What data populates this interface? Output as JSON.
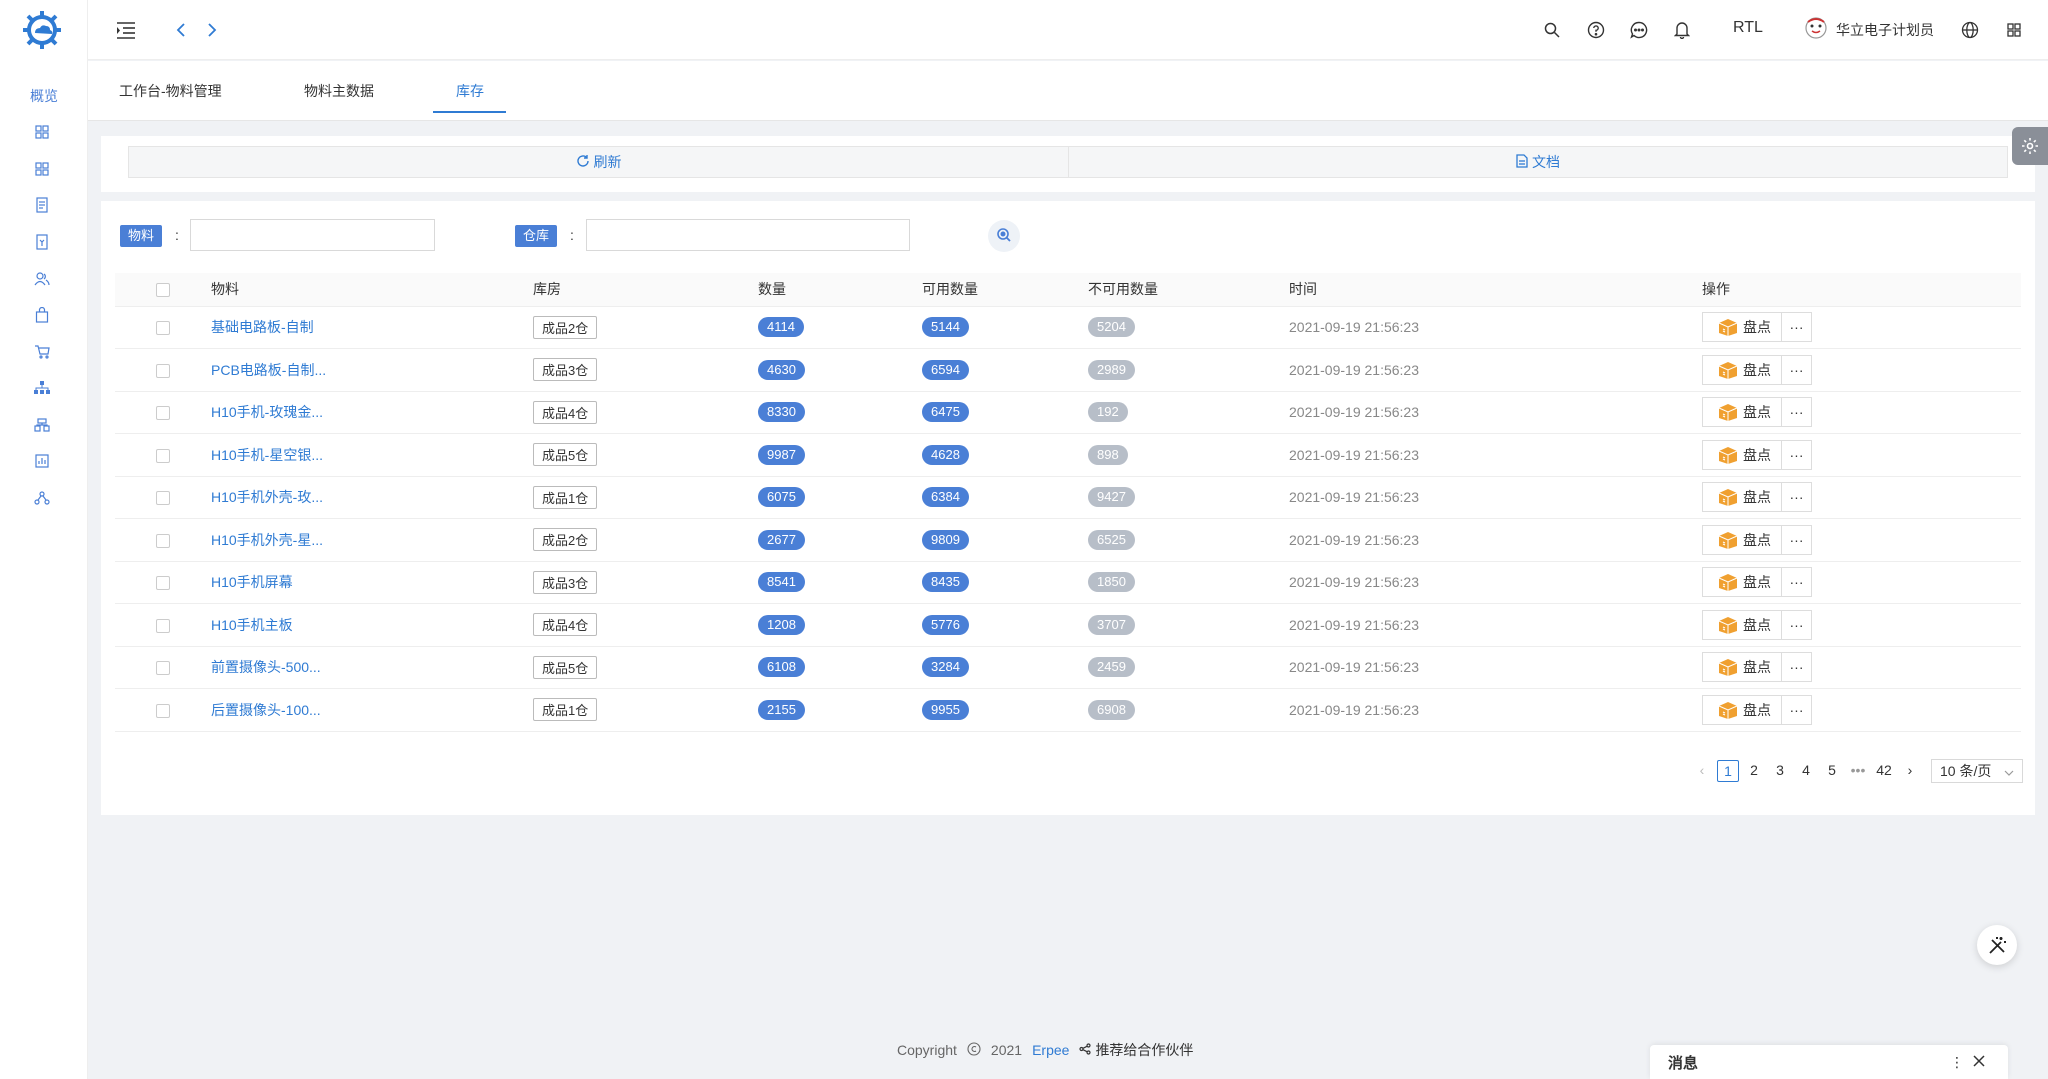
{
  "sidebar": {
    "overview_label": "概览",
    "icons": [
      "grid-icon",
      "grid-icon",
      "document-icon",
      "invoice-icon",
      "users-icon",
      "bag-icon",
      "cart-icon",
      "org-icon",
      "warehouse-icon",
      "report-icon",
      "network-icon"
    ]
  },
  "topbar": {
    "rtl_label": "RTL",
    "user_name": "华立电子计划员"
  },
  "tabs": [
    {
      "label": "工作台-物料管理"
    },
    {
      "label": "物料主数据"
    },
    {
      "label": "库存"
    }
  ],
  "toolbar": {
    "refresh_label": "刷新",
    "docs_label": "文档"
  },
  "filters": {
    "material_label": "物料",
    "warehouse_label": "仓库",
    "colon": ":",
    "material_value": "",
    "warehouse_value": ""
  },
  "table": {
    "headers": {
      "material": "物料",
      "warehouse": "库房",
      "quantity": "数量",
      "available": "可用数量",
      "unavailable": "不可用数量",
      "time": "时间",
      "actions": "操作"
    },
    "action_label": "盘点",
    "more_label": "···",
    "rows": [
      {
        "material": "基础电路板-自制",
        "warehouse": "成品2仓",
        "quantity": "4114",
        "available": "5144",
        "unavailable": "5204",
        "time": "2021-09-19 21:56:23"
      },
      {
        "material": "PCB电路板-自制...",
        "warehouse": "成品3仓",
        "quantity": "4630",
        "available": "6594",
        "unavailable": "2989",
        "time": "2021-09-19 21:56:23"
      },
      {
        "material": "H10手机-玫瑰金...",
        "warehouse": "成品4仓",
        "quantity": "8330",
        "available": "6475",
        "unavailable": "192",
        "time": "2021-09-19 21:56:23"
      },
      {
        "material": "H10手机-星空银...",
        "warehouse": "成品5仓",
        "quantity": "9987",
        "available": "4628",
        "unavailable": "898",
        "time": "2021-09-19 21:56:23"
      },
      {
        "material": "H10手机外壳-玫...",
        "warehouse": "成品1仓",
        "quantity": "6075",
        "available": "6384",
        "unavailable": "9427",
        "time": "2021-09-19 21:56:23"
      },
      {
        "material": "H10手机外壳-星...",
        "warehouse": "成品2仓",
        "quantity": "2677",
        "available": "9809",
        "unavailable": "6525",
        "time": "2021-09-19 21:56:23"
      },
      {
        "material": "H10手机屏幕",
        "warehouse": "成品3仓",
        "quantity": "8541",
        "available": "8435",
        "unavailable": "1850",
        "time": "2021-09-19 21:56:23"
      },
      {
        "material": "H10手机主板",
        "warehouse": "成品4仓",
        "quantity": "1208",
        "available": "5776",
        "unavailable": "3707",
        "time": "2021-09-19 21:56:23"
      },
      {
        "material": "前置摄像头-500...",
        "warehouse": "成品5仓",
        "quantity": "6108",
        "available": "3284",
        "unavailable": "2459",
        "time": "2021-09-19 21:56:23"
      },
      {
        "material": "后置摄像头-100...",
        "warehouse": "成品1仓",
        "quantity": "2155",
        "available": "9955",
        "unavailable": "6908",
        "time": "2021-09-19 21:56:23"
      }
    ]
  },
  "pagination": {
    "pages": [
      "1",
      "2",
      "3",
      "4",
      "5"
    ],
    "ellipsis": "•••",
    "last_page": "42",
    "page_size": "10 条/页",
    "current": "1"
  },
  "footer": {
    "copyright": "Copyright",
    "year": "2021",
    "brand": "Erpee",
    "partner": "推荐给合作伙伴"
  },
  "message_panel": {
    "title": "消息"
  },
  "colors": {
    "accent": "#2f7bd3",
    "pill_blue": "#4a7fd6",
    "pill_gray": "#b7bec8",
    "action_orange": "#f0a030"
  }
}
